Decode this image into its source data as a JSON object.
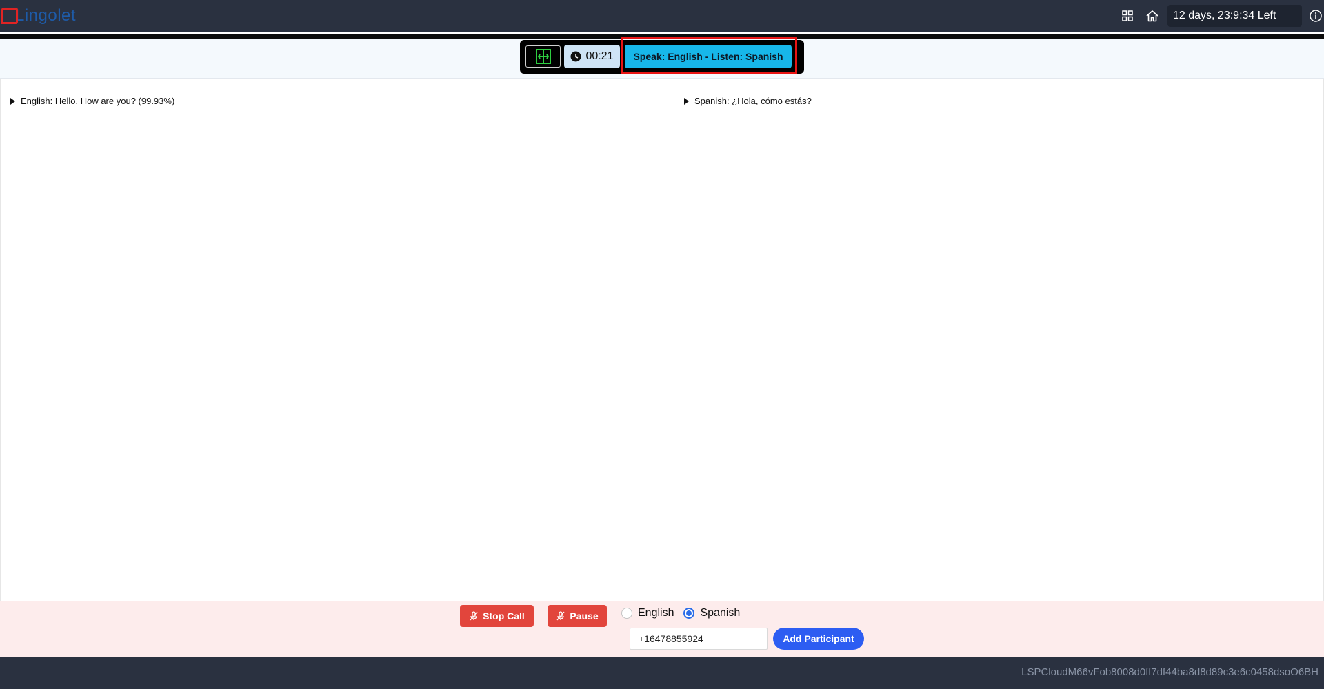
{
  "header": {
    "logo_text": "Lingolet",
    "time_left": "12 days, 23:9:34 Left",
    "icons": [
      "grid-icon",
      "home-icon",
      "info-icon"
    ]
  },
  "call_bar": {
    "timer": "00:21",
    "mode_label": "Speak: English - Listen: Spanish"
  },
  "transcripts": {
    "left": "English: Hello. How are you? (99.93%)",
    "right": "Spanish: ¿Hola, cómo estás?"
  },
  "controls": {
    "stop_label": "Stop Call",
    "pause_label": "Pause",
    "languages": [
      {
        "label": "English",
        "selected": false
      },
      {
        "label": "Spanish",
        "selected": true
      }
    ],
    "phone_value": "+16478855924",
    "add_label": "Add Participant"
  },
  "footer": {
    "session_id": "_LSPCloudM66vFob8008d0ff7df44ba8d8d89c3e6c0458dsoO6BH"
  },
  "colors": {
    "topbar": "#2a3140",
    "accent": "#17b7ea",
    "danger": "#e2453c",
    "primary": "#2d5df2",
    "highlight": "#e81414"
  }
}
